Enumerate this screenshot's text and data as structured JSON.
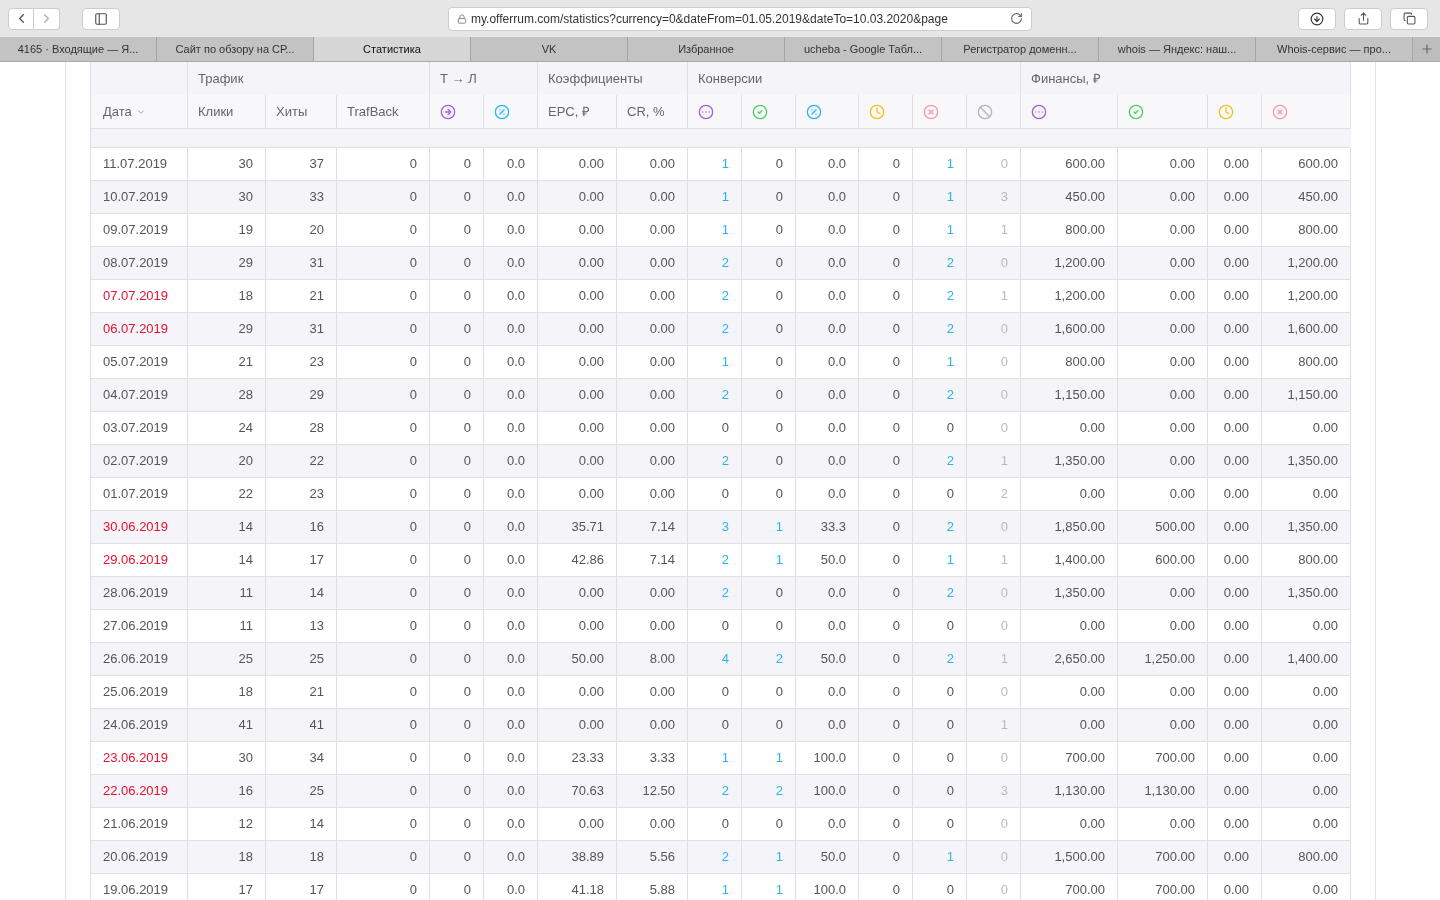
{
  "browser": {
    "url": "my.offerrum.com/statistics?currency=0&dateFrom=01.05.2019&dateTo=10.03.2020&page",
    "tabs": [
      {
        "label": "4165 · Входящие — Я...",
        "selected": false
      },
      {
        "label": "Сайт по обзору на СР...",
        "selected": false
      },
      {
        "label": "Статистика",
        "selected": true
      },
      {
        "label": "VK",
        "selected": false
      },
      {
        "label": "Избранное",
        "selected": false
      },
      {
        "label": "ucheba - Google Табл...",
        "selected": false
      },
      {
        "label": "Регистратор доменн...",
        "selected": false
      },
      {
        "label": "whois — Яндекс: наш...",
        "selected": false
      },
      {
        "label": "Whois-сервис — про...",
        "selected": false
      }
    ]
  },
  "table": {
    "groups": [
      "Трафик",
      "Т → Л",
      "Коэффициенты",
      "Конверсии",
      "Финансы, ₽"
    ],
    "columns": [
      {
        "kind": "text",
        "label": "Дата",
        "sorted": true
      },
      {
        "kind": "text",
        "label": "Клики",
        "sorted": false
      },
      {
        "kind": "text",
        "label": "Хиты",
        "sorted": false
      },
      {
        "kind": "text",
        "label": "TrafBack",
        "sorted": false
      },
      {
        "kind": "arrow"
      },
      {
        "kind": "percent"
      },
      {
        "kind": "text",
        "label": "EPC, ₽",
        "sorted": false
      },
      {
        "kind": "text",
        "label": "CR, %",
        "sorted": false
      },
      {
        "kind": "all"
      },
      {
        "kind": "approved"
      },
      {
        "kind": "percent"
      },
      {
        "kind": "hold"
      },
      {
        "kind": "rejected"
      },
      {
        "kind": "trash"
      },
      {
        "kind": "all"
      },
      {
        "kind": "approved"
      },
      {
        "kind": "hold"
      },
      {
        "kind": "rejected"
      }
    ],
    "rows": [
      {
        "weekend": false,
        "cells": [
          "11.07.2019",
          "30",
          "37",
          "0",
          "0",
          "0.0",
          "0.00",
          "0.00",
          "1",
          "0",
          "0.0",
          "0",
          "1",
          "0",
          "600.00",
          "0.00",
          "0.00",
          "600.00"
        ]
      },
      {
        "weekend": false,
        "cells": [
          "10.07.2019",
          "30",
          "33",
          "0",
          "0",
          "0.0",
          "0.00",
          "0.00",
          "1",
          "0",
          "0.0",
          "0",
          "1",
          "3",
          "450.00",
          "0.00",
          "0.00",
          "450.00"
        ]
      },
      {
        "weekend": false,
        "cells": [
          "09.07.2019",
          "19",
          "20",
          "0",
          "0",
          "0.0",
          "0.00",
          "0.00",
          "1",
          "0",
          "0.0",
          "0",
          "1",
          "1",
          "800.00",
          "0.00",
          "0.00",
          "800.00"
        ]
      },
      {
        "weekend": false,
        "cells": [
          "08.07.2019",
          "29",
          "31",
          "0",
          "0",
          "0.0",
          "0.00",
          "0.00",
          "2",
          "0",
          "0.0",
          "0",
          "2",
          "0",
          "1,200.00",
          "0.00",
          "0.00",
          "1,200.00"
        ]
      },
      {
        "weekend": true,
        "cells": [
          "07.07.2019",
          "18",
          "21",
          "0",
          "0",
          "0.0",
          "0.00",
          "0.00",
          "2",
          "0",
          "0.0",
          "0",
          "2",
          "1",
          "1,200.00",
          "0.00",
          "0.00",
          "1,200.00"
        ]
      },
      {
        "weekend": true,
        "cells": [
          "06.07.2019",
          "29",
          "31",
          "0",
          "0",
          "0.0",
          "0.00",
          "0.00",
          "2",
          "0",
          "0.0",
          "0",
          "2",
          "0",
          "1,600.00",
          "0.00",
          "0.00",
          "1,600.00"
        ]
      },
      {
        "weekend": false,
        "cells": [
          "05.07.2019",
          "21",
          "23",
          "0",
          "0",
          "0.0",
          "0.00",
          "0.00",
          "1",
          "0",
          "0.0",
          "0",
          "1",
          "0",
          "800.00",
          "0.00",
          "0.00",
          "800.00"
        ]
      },
      {
        "weekend": false,
        "cells": [
          "04.07.2019",
          "28",
          "29",
          "0",
          "0",
          "0.0",
          "0.00",
          "0.00",
          "2",
          "0",
          "0.0",
          "0",
          "2",
          "0",
          "1,150.00",
          "0.00",
          "0.00",
          "1,150.00"
        ]
      },
      {
        "weekend": false,
        "cells": [
          "03.07.2019",
          "24",
          "28",
          "0",
          "0",
          "0.0",
          "0.00",
          "0.00",
          "0",
          "0",
          "0.0",
          "0",
          "0",
          "0",
          "0.00",
          "0.00",
          "0.00",
          "0.00"
        ]
      },
      {
        "weekend": false,
        "cells": [
          "02.07.2019",
          "20",
          "22",
          "0",
          "0",
          "0.0",
          "0.00",
          "0.00",
          "2",
          "0",
          "0.0",
          "0",
          "2",
          "1",
          "1,350.00",
          "0.00",
          "0.00",
          "1,350.00"
        ]
      },
      {
        "weekend": false,
        "cells": [
          "01.07.2019",
          "22",
          "23",
          "0",
          "0",
          "0.0",
          "0.00",
          "0.00",
          "0",
          "0",
          "0.0",
          "0",
          "0",
          "2",
          "0.00",
          "0.00",
          "0.00",
          "0.00"
        ]
      },
      {
        "weekend": true,
        "cells": [
          "30.06.2019",
          "14",
          "16",
          "0",
          "0",
          "0.0",
          "35.71",
          "7.14",
          "3",
          "1",
          "33.3",
          "0",
          "2",
          "0",
          "1,850.00",
          "500.00",
          "0.00",
          "1,350.00"
        ]
      },
      {
        "weekend": true,
        "cells": [
          "29.06.2019",
          "14",
          "17",
          "0",
          "0",
          "0.0",
          "42.86",
          "7.14",
          "2",
          "1",
          "50.0",
          "0",
          "1",
          "1",
          "1,400.00",
          "600.00",
          "0.00",
          "800.00"
        ]
      },
      {
        "weekend": false,
        "cells": [
          "28.06.2019",
          "11",
          "14",
          "0",
          "0",
          "0.0",
          "0.00",
          "0.00",
          "2",
          "0",
          "0.0",
          "0",
          "2",
          "0",
          "1,350.00",
          "0.00",
          "0.00",
          "1,350.00"
        ]
      },
      {
        "weekend": false,
        "cells": [
          "27.06.2019",
          "11",
          "13",
          "0",
          "0",
          "0.0",
          "0.00",
          "0.00",
          "0",
          "0",
          "0.0",
          "0",
          "0",
          "0",
          "0.00",
          "0.00",
          "0.00",
          "0.00"
        ]
      },
      {
        "weekend": false,
        "cells": [
          "26.06.2019",
          "25",
          "25",
          "0",
          "0",
          "0.0",
          "50.00",
          "8.00",
          "4",
          "2",
          "50.0",
          "0",
          "2",
          "1",
          "2,650.00",
          "1,250.00",
          "0.00",
          "1,400.00"
        ]
      },
      {
        "weekend": false,
        "cells": [
          "25.06.2019",
          "18",
          "21",
          "0",
          "0",
          "0.0",
          "0.00",
          "0.00",
          "0",
          "0",
          "0.0",
          "0",
          "0",
          "0",
          "0.00",
          "0.00",
          "0.00",
          "0.00"
        ]
      },
      {
        "weekend": false,
        "cells": [
          "24.06.2019",
          "41",
          "41",
          "0",
          "0",
          "0.0",
          "0.00",
          "0.00",
          "0",
          "0",
          "0.0",
          "0",
          "0",
          "1",
          "0.00",
          "0.00",
          "0.00",
          "0.00"
        ]
      },
      {
        "weekend": true,
        "cells": [
          "23.06.2019",
          "30",
          "34",
          "0",
          "0",
          "0.0",
          "23.33",
          "3.33",
          "1",
          "1",
          "100.0",
          "0",
          "0",
          "0",
          "700.00",
          "700.00",
          "0.00",
          "0.00"
        ]
      },
      {
        "weekend": true,
        "cells": [
          "22.06.2019",
          "16",
          "25",
          "0",
          "0",
          "0.0",
          "70.63",
          "12.50",
          "2",
          "2",
          "100.0",
          "0",
          "0",
          "3",
          "1,130.00",
          "1,130.00",
          "0.00",
          "0.00"
        ]
      },
      {
        "weekend": false,
        "cells": [
          "21.06.2019",
          "12",
          "14",
          "0",
          "0",
          "0.0",
          "0.00",
          "0.00",
          "0",
          "0",
          "0.0",
          "0",
          "0",
          "0",
          "0.00",
          "0.00",
          "0.00",
          "0.00"
        ]
      },
      {
        "weekend": false,
        "cells": [
          "20.06.2019",
          "18",
          "18",
          "0",
          "0",
          "0.0",
          "38.89",
          "5.56",
          "2",
          "1",
          "50.0",
          "0",
          "1",
          "0",
          "1,500.00",
          "700.00",
          "0.00",
          "800.00"
        ]
      },
      {
        "weekend": false,
        "cells": [
          "19.06.2019",
          "17",
          "17",
          "0",
          "0",
          "0.0",
          "41.18",
          "5.88",
          "1",
          "1",
          "100.0",
          "0",
          "0",
          "0",
          "700.00",
          "700.00",
          "0.00",
          "0.00"
        ]
      }
    ]
  }
}
